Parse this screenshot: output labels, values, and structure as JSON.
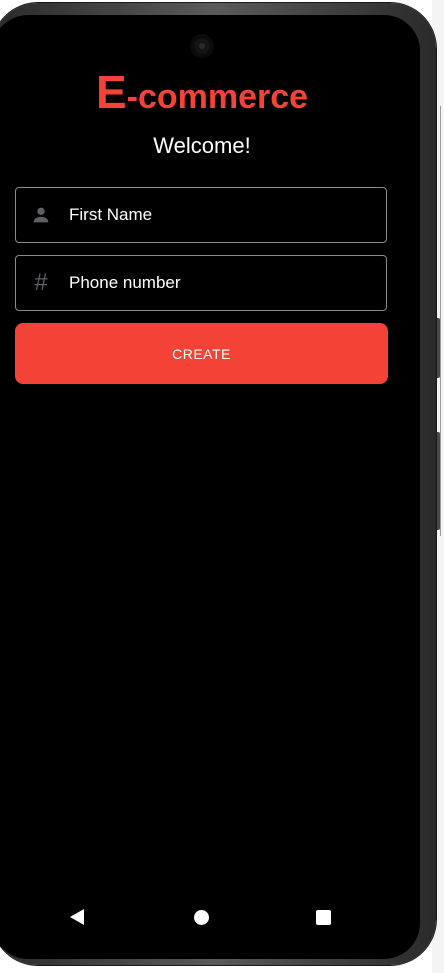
{
  "app": {
    "logo_initial": "E",
    "logo_rest": "-commerce",
    "welcome": "Welcome!"
  },
  "form": {
    "first_name": {
      "placeholder": "First Name",
      "value": "",
      "icon": "person-icon"
    },
    "phone": {
      "placeholder": "Phone number",
      "value": "",
      "icon": "hash-icon",
      "icon_glyph": "#"
    },
    "create_label": "CREATE"
  },
  "navbar": {
    "back": "back-icon",
    "home": "home-icon",
    "recents": "recents-icon"
  },
  "colors": {
    "accent": "#f44336",
    "background": "#000000",
    "text": "#ffffff",
    "outline": "#8a8a8a"
  }
}
